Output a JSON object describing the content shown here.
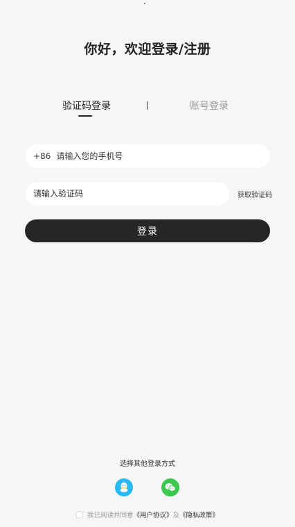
{
  "page": {
    "title": "你好，欢迎登录/注册"
  },
  "tabs": {
    "sms_login": "验证码登录",
    "account_login": "账号登录",
    "active": "sms_login"
  },
  "phone": {
    "prefix": "+86",
    "placeholder": "请输入您的手机号"
  },
  "code": {
    "placeholder": "请输入验证码",
    "get_code_label": "获取验证码"
  },
  "login_button": "登录",
  "other_login": {
    "title": "选择其他登录方式",
    "methods": [
      "qq-icon",
      "wechat-icon"
    ]
  },
  "agreement": {
    "prefix": "我已阅读并同意",
    "user_agreement": "《用户协议》",
    "conjunction": "及",
    "privacy_policy": "《隐私政策》"
  },
  "colors": {
    "background": "#f5f6f8",
    "primary_button": "#252628",
    "qq": "#29b9f2",
    "wechat": "#3cc74f"
  }
}
